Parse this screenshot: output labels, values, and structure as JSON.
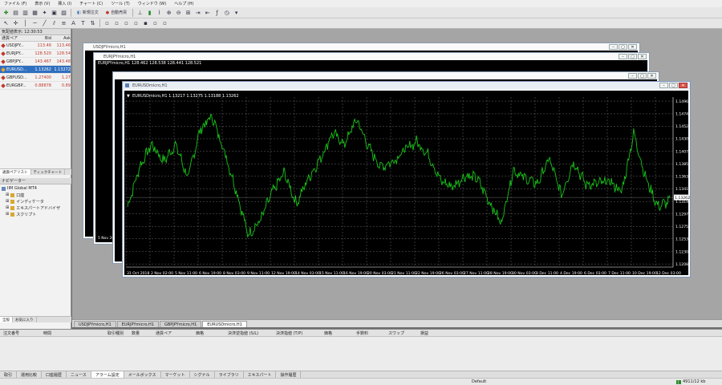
{
  "menubar": {
    "items": [
      "ファイル (F)",
      "表示 (V)",
      "挿入 (I)",
      "チャート (C)",
      "ツール (T)",
      "ウィンドウ (W)",
      "ヘルプ (H)"
    ]
  },
  "toolbar": {
    "new_order_label": "新規注文",
    "auto_trade_label": "自動売買"
  },
  "market_watch": {
    "title": "気配値表示: 12:30:53",
    "headers": {
      "symbol": "通貨ペア",
      "bid": "Bid",
      "ask": "Ask"
    },
    "rows": [
      {
        "symbol": "USDJPY...",
        "bid": "113.46",
        "ask": "113.46",
        "color": "#c0392b"
      },
      {
        "symbol": "EURJPY...",
        "bid": "128.520",
        "ask": "128.54",
        "color": "#c0392b"
      },
      {
        "symbol": "GBPJPY...",
        "bid": "143.467",
        "ask": "143.48",
        "color": "#c0392b"
      },
      {
        "symbol": "EURUSD...",
        "bid": "1.13262",
        "ask": "1.13272",
        "color": "#c0392b",
        "selected": true
      },
      {
        "symbol": "GBPUSD...",
        "bid": "1.27400",
        "ask": "1.27",
        "color": "#c0392b"
      },
      {
        "symbol": "EURGBP...",
        "bid": "0.88878",
        "ask": "0.89",
        "color": "#c0392b"
      }
    ],
    "tabs": [
      "通貨ペアリスト",
      "ティックチャート"
    ]
  },
  "navigator": {
    "title": "ナビゲーター",
    "items": [
      "IIM Global MT4",
      "口座",
      "インディケータ",
      "エキスパートアドバイザ",
      "スクリプト"
    ],
    "tabs": [
      "全般",
      "お気に入り"
    ]
  },
  "chart_tabs": [
    "USDJPYmicro,H1",
    "EURJPYmicro,H1",
    "GBPJPYmicro,H1",
    "EURUSDmicro,H1"
  ],
  "windows": {
    "w1_title": "USDJPYmicro,H1",
    "w2_title": "EURJPYmicro,H1",
    "w2_label": "EURJPYmicro,H1  128.462 128.538 128.441 128.521",
    "w2_date": "5 Nov 20",
    "w3_title": "",
    "front_title": "EURUSDmicro,H1"
  },
  "chart_data": {
    "type": "line",
    "label": "EURUSDmicro,H1  1.13217 1.13275 1.13188 1.13262",
    "current_price": "1.13262",
    "color": "#19c319",
    "grid": true,
    "ylim": [
      1.1203,
      1.1498
    ],
    "y_ticks": [
      "1.14965",
      "1.14740",
      "1.14520",
      "1.14300",
      "1.14075",
      "1.13855",
      "1.13635",
      "1.13415",
      "1.13190",
      "1.12970",
      "1.12750",
      "1.12530",
      "1.12305",
      "1.12085"
    ],
    "x_ticks": [
      "31 Oct 2018",
      "2 Nov 02:00",
      "5 Nov 11:00",
      "6 Nov 19:00",
      "8 Nov 03:00",
      "9 Nov 11:00",
      "12 Nov 19:00",
      "14 Nov 03:00",
      "15 Nov 11:00",
      "16 Nov 19:00",
      "20 Nov 03:00",
      "21 Nov 11:00",
      "22 Nov 19:00",
      "26 Nov 03:00",
      "27 Nov 11:00",
      "28 Nov 19:00",
      "30 Nov 03:00",
      "3 Dec 11:00",
      "4 Dec 19:00",
      "6 Dec 03:00",
      "7 Dec 11:00",
      "10 Dec 19:00",
      "12 Dec 03:00"
    ],
    "anchors": [
      1.131,
      1.138,
      1.142,
      1.139,
      1.142,
      1.136,
      1.1445,
      1.147,
      1.141,
      1.134,
      1.126,
      1.1285,
      1.1335,
      1.137,
      1.1315,
      1.136,
      1.1395,
      1.144,
      1.142,
      1.1465,
      1.1415,
      1.138,
      1.139,
      1.141,
      1.1425,
      1.14,
      1.1355,
      1.1345,
      1.1365,
      1.136,
      1.132,
      1.128,
      1.1375,
      1.136,
      1.135,
      1.1395,
      1.133,
      1.139,
      1.135,
      1.135,
      1.1355,
      1.1335,
      1.144,
      1.136,
      1.131,
      1.132
    ]
  },
  "terminal": {
    "headers": [
      "注文番号",
      "時間",
      "取引種別",
      "数量",
      "通貨ペア",
      "価格",
      "決済逆指値 (S/L)",
      "決済指値 (T/P)",
      "価格",
      "手数料",
      "スワップ",
      "損益"
    ],
    "tabs": [
      "取引",
      "運用比較",
      "口座履歴",
      "ニュース",
      "アラーム設定",
      "メールボックス",
      "マーケット",
      "シグナル",
      "ライブラリ",
      "エキスパート",
      "操作履歴"
    ]
  },
  "status": {
    "profile": "Default",
    "connection": "4911/12 kb"
  }
}
